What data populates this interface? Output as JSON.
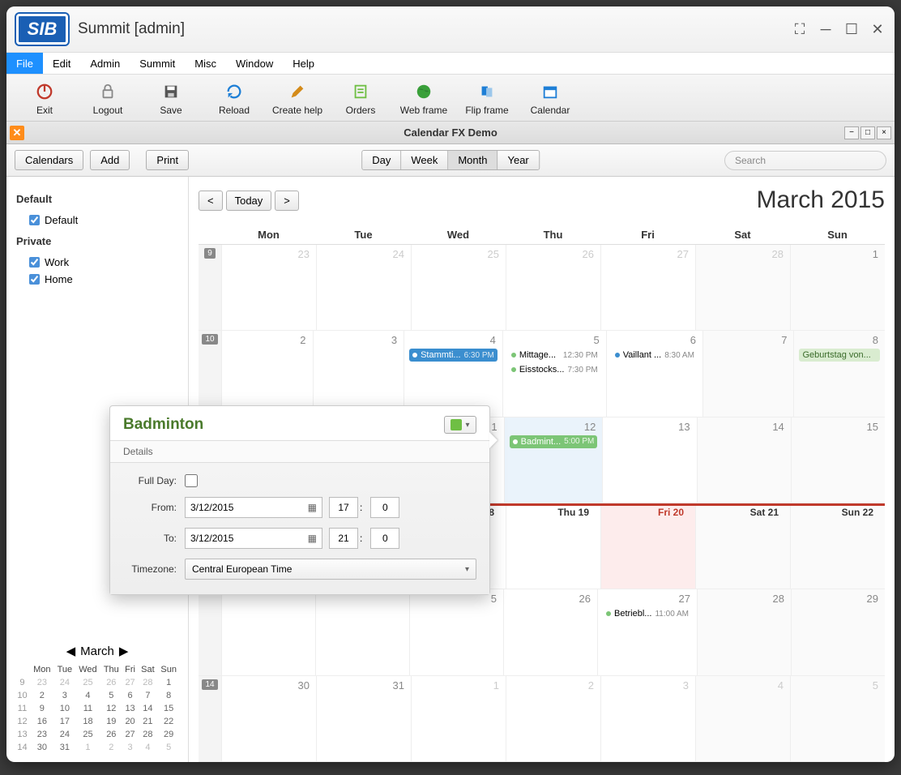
{
  "window": {
    "title": "Summit [admin]",
    "logo": "SIB"
  },
  "menubar": [
    "File",
    "Edit",
    "Admin",
    "Summit",
    "Misc",
    "Window",
    "Help"
  ],
  "toolbar": [
    {
      "label": "Exit",
      "icon": "power",
      "color": "#c0392b"
    },
    {
      "label": "Logout",
      "icon": "lock",
      "color": "#888"
    },
    {
      "label": "Save",
      "icon": "floppy",
      "color": "#444"
    },
    {
      "label": "Reload",
      "icon": "reload",
      "color": "#1e7fd6"
    },
    {
      "label": "Create help",
      "icon": "pencil",
      "color": "#d48b1a"
    },
    {
      "label": "Orders",
      "icon": "orders",
      "color": "#6fbf44"
    },
    {
      "label": "Web frame",
      "icon": "globe",
      "color": "#2e8b57"
    },
    {
      "label": "Flip frame",
      "icon": "flip",
      "color": "#1e7fd6"
    },
    {
      "label": "Calendar",
      "icon": "calendar",
      "color": "#1e7fd6"
    }
  ],
  "subheader": {
    "title": "Calendar FX Demo"
  },
  "ctrl": {
    "calendars": "Calendars",
    "add": "Add",
    "print": "Print",
    "views": [
      "Day",
      "Week",
      "Month",
      "Year"
    ],
    "active_view": "Month",
    "search_placeholder": "Search"
  },
  "sidebar": {
    "groups": [
      {
        "name": "Default",
        "items": [
          {
            "label": "Default",
            "checked": true
          }
        ]
      },
      {
        "name": "Private",
        "items": [
          {
            "label": "Work",
            "checked": true
          },
          {
            "label": "Home",
            "checked": true
          }
        ]
      }
    ]
  },
  "nav": {
    "today": "Today",
    "month_title": "March 2015"
  },
  "dow": [
    "Mon",
    "Tue",
    "Wed",
    "Thu",
    "Fri",
    "Sat",
    "Sun"
  ],
  "weeks": [
    {
      "no": "9",
      "days": [
        {
          "n": "23",
          "other": true
        },
        {
          "n": "24",
          "other": true
        },
        {
          "n": "25",
          "other": true
        },
        {
          "n": "26",
          "other": true
        },
        {
          "n": "27",
          "other": true
        },
        {
          "n": "28",
          "other": true,
          "wkend": true
        },
        {
          "n": "1",
          "wkend": true
        }
      ]
    },
    {
      "no": "10",
      "days": [
        {
          "n": "2"
        },
        {
          "n": "3"
        },
        {
          "n": "4",
          "events": [
            {
              "style": "blue",
              "title": "Stammti...",
              "time": "6:30 PM"
            }
          ]
        },
        {
          "n": "5",
          "events": [
            {
              "style": "plain",
              "dot": "green",
              "title": "Mittage...",
              "time": "12:30 PM"
            },
            {
              "style": "plain",
              "dot": "green",
              "title": "Eisstocks...",
              "time": "7:30 PM"
            }
          ]
        },
        {
          "n": "6",
          "events": [
            {
              "style": "plain",
              "dot": "blue",
              "title": "Vaillant ...",
              "time": "8:30 AM"
            }
          ]
        },
        {
          "n": "7",
          "wkend": true
        },
        {
          "n": "8",
          "wkend": true,
          "events": [
            {
              "style": "green-lt",
              "title": "Geburtstag von..."
            }
          ]
        }
      ]
    },
    {
      "no": "",
      "days": [
        {
          "n": ""
        },
        {
          "n": ""
        },
        {
          "n": "1"
        },
        {
          "n": "12",
          "today": true,
          "events": [
            {
              "style": "green-bg",
              "title": "Badmint...",
              "time": "5:00 PM"
            }
          ]
        },
        {
          "n": "13"
        },
        {
          "n": "14",
          "wkend": true
        },
        {
          "n": "15",
          "wkend": true
        }
      ]
    },
    {
      "no": "",
      "red": true,
      "days": [
        {
          "label": "",
          "n": ""
        },
        {
          "label": "",
          "n": ""
        },
        {
          "label": "8",
          "n": ""
        },
        {
          "label": "Thu 19",
          "n": ""
        },
        {
          "label": "Fri 20",
          "n": "",
          "holiday": true
        },
        {
          "label": "Sat 21",
          "n": "",
          "wkend": true
        },
        {
          "label": "Sun 22",
          "n": "",
          "wkend": true
        }
      ]
    },
    {
      "no": "",
      "days": [
        {
          "n": ""
        },
        {
          "n": ""
        },
        {
          "n": "5"
        },
        {
          "n": "26"
        },
        {
          "n": "27",
          "events": [
            {
              "style": "plain",
              "dot": "green",
              "title": "Betriebl...",
              "time": "11:00 AM"
            }
          ]
        },
        {
          "n": "28",
          "wkend": true
        },
        {
          "n": "29",
          "wkend": true
        }
      ]
    },
    {
      "no": "14",
      "days": [
        {
          "n": "30"
        },
        {
          "n": "31"
        },
        {
          "n": "1",
          "other": true
        },
        {
          "n": "2",
          "other": true
        },
        {
          "n": "3",
          "other": true
        },
        {
          "n": "4",
          "other": true,
          "wkend": true
        },
        {
          "n": "5",
          "other": true,
          "wkend": true
        }
      ]
    }
  ],
  "popup": {
    "title": "Badminton",
    "tab": "Details",
    "fullday_label": "Full Day:",
    "fullday": false,
    "from_label": "From:",
    "from_date": "3/12/2015",
    "from_h": "17",
    "from_m": "0",
    "to_label": "To:",
    "to_date": "3/12/2015",
    "to_h": "21",
    "to_m": "0",
    "tz_label": "Timezone:",
    "tz": "Central European Time"
  },
  "mini": {
    "title": "March",
    "dow": [
      "Mon",
      "Tue",
      "Wed",
      "Thu",
      "Fri",
      "Sat",
      "Sun"
    ],
    "rows": [
      {
        "wk": "9",
        "d": [
          {
            "v": "23",
            "o": true
          },
          {
            "v": "24",
            "o": true
          },
          {
            "v": "25",
            "o": true
          },
          {
            "v": "26",
            "o": true
          },
          {
            "v": "27",
            "o": true
          },
          {
            "v": "28",
            "o": true
          },
          {
            "v": "1"
          }
        ]
      },
      {
        "wk": "10",
        "d": [
          {
            "v": "2"
          },
          {
            "v": "3"
          },
          {
            "v": "4"
          },
          {
            "v": "5"
          },
          {
            "v": "6"
          },
          {
            "v": "7"
          },
          {
            "v": "8"
          }
        ]
      },
      {
        "wk": "11",
        "d": [
          {
            "v": "9"
          },
          {
            "v": "10"
          },
          {
            "v": "11"
          },
          {
            "v": "12"
          },
          {
            "v": "13"
          },
          {
            "v": "14"
          },
          {
            "v": "15"
          }
        ]
      },
      {
        "wk": "12",
        "d": [
          {
            "v": "16"
          },
          {
            "v": "17"
          },
          {
            "v": "18"
          },
          {
            "v": "19"
          },
          {
            "v": "20"
          },
          {
            "v": "21"
          },
          {
            "v": "22"
          }
        ]
      },
      {
        "wk": "13",
        "d": [
          {
            "v": "23"
          },
          {
            "v": "24"
          },
          {
            "v": "25"
          },
          {
            "v": "26"
          },
          {
            "v": "27"
          },
          {
            "v": "28"
          },
          {
            "v": "29"
          }
        ]
      },
      {
        "wk": "14",
        "d": [
          {
            "v": "30"
          },
          {
            "v": "31"
          },
          {
            "v": "1",
            "o": true
          },
          {
            "v": "2",
            "o": true
          },
          {
            "v": "3",
            "o": true
          },
          {
            "v": "4",
            "o": true
          },
          {
            "v": "5",
            "o": true
          }
        ]
      }
    ]
  }
}
